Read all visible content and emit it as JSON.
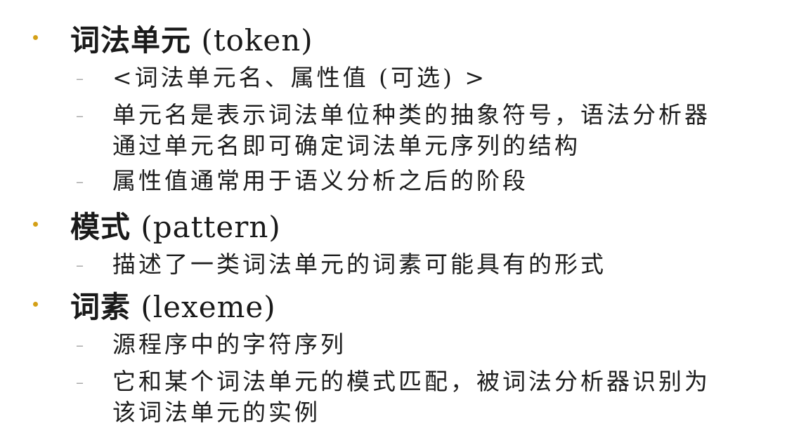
{
  "accent_color": "#d4a017",
  "items": [
    {
      "title_cn": "词法单元",
      "title_en": " (token)",
      "subs": [
        {
          "lines": [
            "<词法单元名、属性值 (可选) >"
          ]
        },
        {
          "lines": [
            "单元名是表示词法单位种类的抽象符号，语法分析器",
            "通过单元名即可确定词法单元序列的结构"
          ]
        },
        {
          "lines": [
            "属性值通常用于语义分析之后的阶段"
          ]
        }
      ]
    },
    {
      "title_cn": "模式",
      "title_en": " (pattern)",
      "subs": [
        {
          "lines": [
            "描述了一类词法单元的词素可能具有的形式"
          ]
        }
      ]
    },
    {
      "title_cn": "词素",
      "title_en": " (lexeme)",
      "subs": [
        {
          "lines": [
            "源程序中的字符序列"
          ]
        },
        {
          "lines": [
            "它和某个词法单元的模式匹配，被词法分析器识别为",
            "该词法单元的实例"
          ]
        }
      ]
    }
  ],
  "sub_dash": "–"
}
